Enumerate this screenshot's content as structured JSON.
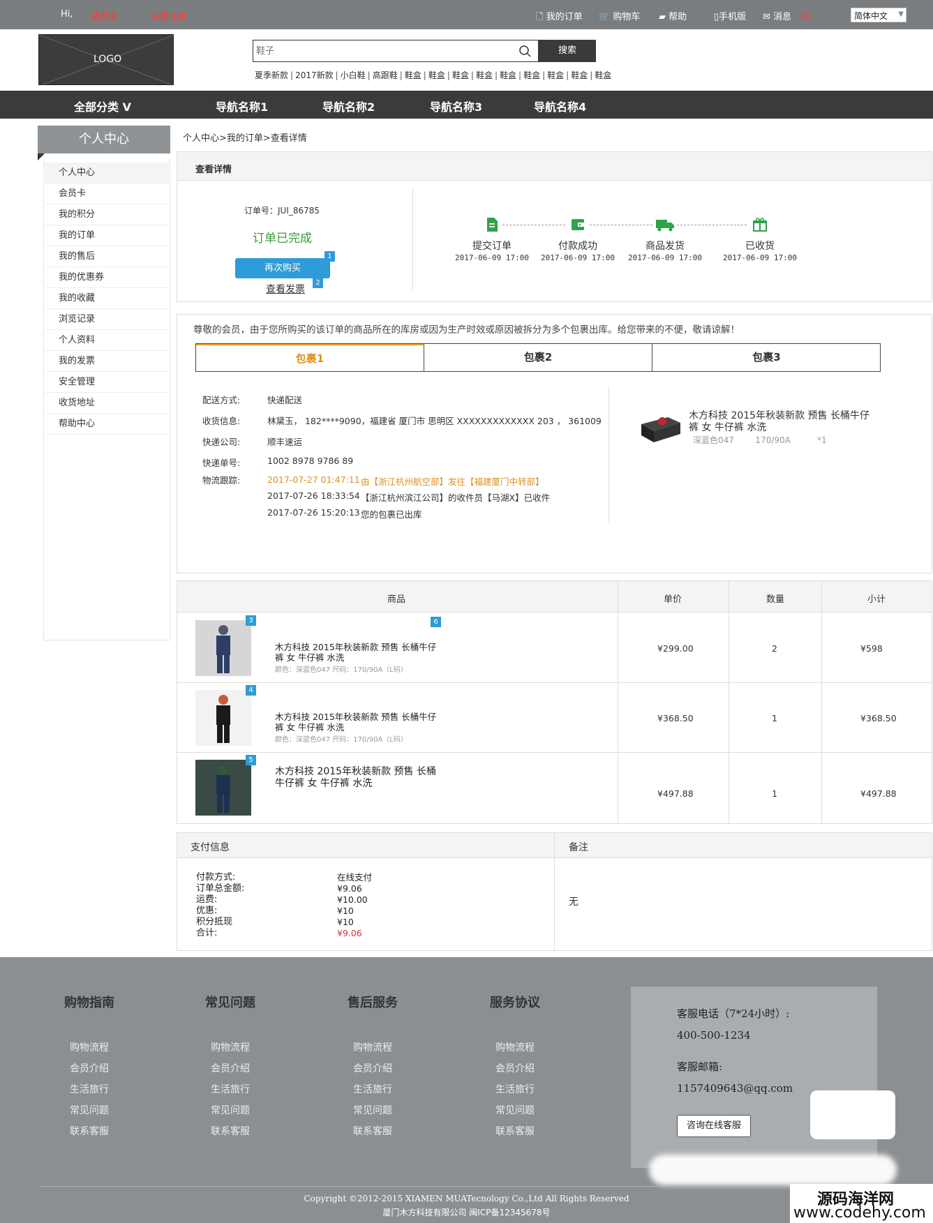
{
  "topbar": {
    "greeting": "Hi,",
    "login": "请登录",
    "register": "快速注册",
    "my_orders": "我的订单",
    "cart": "购物车",
    "help": "帮助",
    "mobile": "手机版",
    "messages": "消息",
    "msg_count": "（0）",
    "language": "简体中文"
  },
  "header": {
    "logo": "LOGO",
    "search_placeholder": "鞋子",
    "search_button": "搜索",
    "hot_words": [
      "夏季新款",
      "2017新款",
      "小白鞋",
      "高跟鞋",
      "鞋盒",
      "鞋盒",
      "鞋盒",
      "鞋盒",
      "鞋盒",
      "鞋盒",
      "鞋盒",
      "鞋盒",
      "鞋盒"
    ]
  },
  "nav": {
    "all": "全部分类 V",
    "items": [
      "导航名称1",
      "导航名称2",
      "导航名称3",
      "导航名称4"
    ]
  },
  "sidebar": {
    "title": "个人中心",
    "items": [
      "个人中心",
      "会员卡",
      "我的积分",
      "我的订单",
      "我的售后",
      "我的优惠券",
      "我的收藏",
      "浏览记录",
      "个人资料",
      "我的发票",
      "安全管理",
      "收货地址",
      "帮助中心"
    ]
  },
  "breadcrumb": "个人中心>我的订单>查看详情",
  "detail": {
    "heading": "查看详情",
    "order_no": "订单号：JUI_86785",
    "status": "订单已完成",
    "rebuy": "再次购买",
    "invoice": "查看发票",
    "badge1": "1",
    "badge2": "2",
    "steps": [
      {
        "label": "提交订单",
        "time": "2017-06-09  17:00"
      },
      {
        "label": "付款成功",
        "time": "2017-06-09  17:00"
      },
      {
        "label": "商品发货",
        "time": "2017-06-09  17:00"
      },
      {
        "label": "已收货",
        "time": "2017-06-09  17:00"
      }
    ]
  },
  "package": {
    "notice": "尊敬的会员，由于您所购买的该订单的商品所在的库房或因为生产时效或原因被拆分为多个包裹出库。给您带来的不便，敬请谅解！",
    "tabs": [
      "包裹1",
      "包裹2",
      "包裹3"
    ],
    "ship_method_label": "配送方式:",
    "ship_method": "快递配送",
    "receiver_label": "收货信息:",
    "receiver": "林黛玉， 182****9090，福建省 厦门市 思明区 XXXXXXXXXXXXX 203 ， 361009",
    "courier_label": "快递公司:",
    "courier": "顺丰速运",
    "tracking_label": "快递单号:",
    "tracking": "1002 8978 9786 89",
    "logistics_label": "物流跟踪:",
    "logistics": [
      {
        "time": "2017-07-27 01:47:11",
        "text": "由【浙江杭州航空部】发往【福建厦门中转部】"
      },
      {
        "time": "2017-07-26 18:33:54",
        "text": "【浙江杭州滨江公司】的收件员【马湖X】已收件"
      },
      {
        "time": "2017-07-26 15:20:13",
        "text": "您的包裹已出库"
      }
    ],
    "item_name": "木方科技 2015年秋装新款 预售 长桶牛仔裤  女 牛仔裤 水洗",
    "item_color": "深蓝色047",
    "item_size": "170/90A",
    "item_qty": "*1"
  },
  "products": {
    "headers": [
      "商品",
      "单价",
      "数量",
      "小计"
    ],
    "badge_name": "6",
    "rows": [
      {
        "badge": "3",
        "name": "木方科技 2015年秋装新款 预售 长桶牛仔裤  女 牛仔裤 水洗",
        "spec": "颜色：深蓝色047   尺码：170/90A（L码）",
        "price": "¥299.00",
        "qty": "2",
        "subtotal": "¥598"
      },
      {
        "badge": "4",
        "name": "木方科技 2015年秋装新款 预售 长桶牛仔裤  女 牛仔裤 水洗",
        "spec": "颜色：深蓝色047   尺码：170/90A（L码）",
        "price": "¥368.50",
        "qty": "1",
        "subtotal": "¥368.50"
      },
      {
        "badge": "5",
        "name": "木方科技 2015年秋装新款 预售 长桶牛仔裤  女 牛仔裤 水洗",
        "spec": "",
        "price": "¥497.88",
        "qty": "1",
        "subtotal": "¥497.88"
      }
    ]
  },
  "payment": {
    "title": "支付信息",
    "remark_title": "备注",
    "remark": "无",
    "labels": [
      "付款方式:",
      "订单总金额:",
      "运费:",
      "优惠:",
      "积分抵现",
      "合计:"
    ],
    "values": [
      "在线支付",
      "¥9.06",
      "¥10.00",
      "¥10",
      "¥10",
      "¥9.06"
    ]
  },
  "footer": {
    "columns": [
      {
        "title": "购物指南",
        "links": [
          "购物流程",
          "会员介绍",
          "生活旅行",
          "常见问题",
          "联系客服"
        ]
      },
      {
        "title": "常见问题",
        "links": [
          "购物流程",
          "会员介绍",
          "生活旅行",
          "常见问题",
          "联系客服"
        ]
      },
      {
        "title": "售后服务",
        "links": [
          "购物流程",
          "会员介绍",
          "生活旅行",
          "常见问题",
          "联系客服"
        ]
      },
      {
        "title": "服务协议",
        "links": [
          "购物流程",
          "会员介绍",
          "生活旅行",
          "常见问题",
          "联系客服"
        ]
      }
    ],
    "phone_label": "客服电话（7*24小时）:",
    "phone": "400-500-1234",
    "email_label": "客服邮箱:",
    "email": "1157409643@qq.com",
    "consult": "咨询在线客服",
    "copyright": "Copyright ©2012-2015 XIAMEN MUATecnology Co.,Ltd All Rights Reserved",
    "icp": "厦门木方科技有限公司 闽ICP备12345678号",
    "watermark1": "源码海洋网",
    "watermark2": "www.codehy.com"
  },
  "colors": {
    "accent": "#2f9bd8",
    "success": "#3a9b3a",
    "warn": "#e09020",
    "nav": "#3b3b3b"
  }
}
